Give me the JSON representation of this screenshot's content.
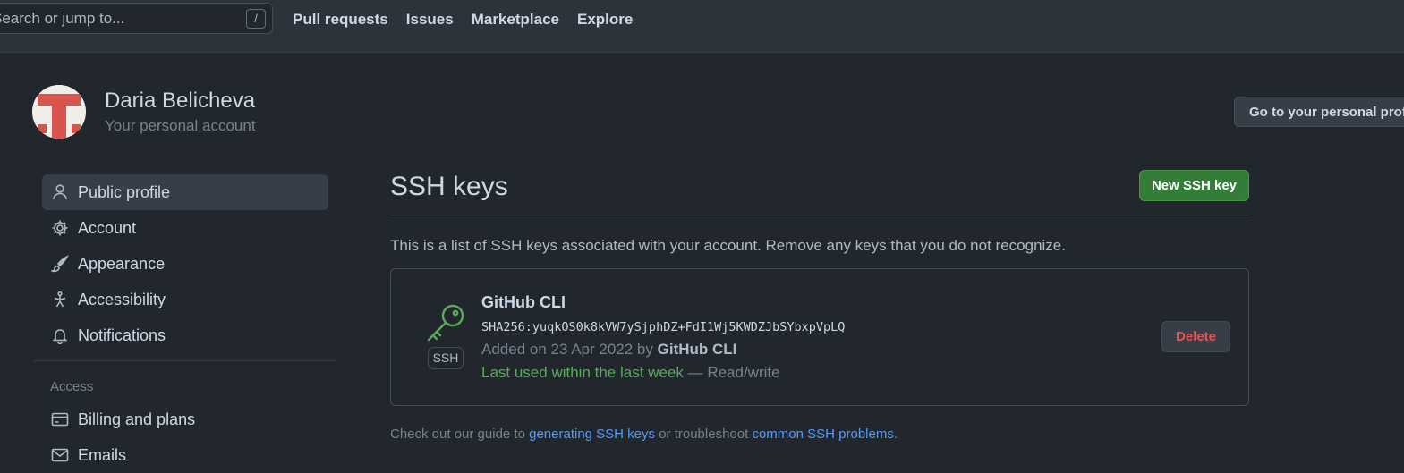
{
  "header": {
    "search_placeholder": "Search or jump to...",
    "search_shortcut": "/",
    "nav": [
      "Pull requests",
      "Issues",
      "Marketplace",
      "Explore"
    ]
  },
  "profile": {
    "name": "Daria Belicheva",
    "subtitle": "Your personal account",
    "goto_button": "Go to your personal profile"
  },
  "sidebar": {
    "items": [
      {
        "label": "Public profile",
        "icon": "person-icon"
      },
      {
        "label": "Account",
        "icon": "gear-icon"
      },
      {
        "label": "Appearance",
        "icon": "paintbrush-icon"
      },
      {
        "label": "Accessibility",
        "icon": "accessibility-icon"
      },
      {
        "label": "Notifications",
        "icon": "bell-icon"
      }
    ],
    "access_heading": "Access",
    "access_items": [
      {
        "label": "Billing and plans",
        "icon": "credit-card-icon"
      },
      {
        "label": "Emails",
        "icon": "mail-icon"
      }
    ]
  },
  "main": {
    "title": "SSH keys",
    "new_button": "New SSH key",
    "intro": "This is a list of SSH keys associated with your account. Remove any keys that you do not recognize.",
    "key": {
      "title": "GitHub CLI",
      "badge": "SSH",
      "fingerprint": "SHA256:yuqkOS0k8kVW7ySjphDZ+FdI1Wj5KWDZJbSYbxpVpLQ",
      "added_prefix": "Added on 23 Apr 2022 by",
      "added_by": "GitHub CLI",
      "last_used": "Last used within the last week",
      "access": "— Read/write",
      "delete_button": "Delete"
    },
    "help": {
      "prefix": "Check out our guide to",
      "link1": "generating SSH keys",
      "middle": "or troubleshoot",
      "link2": "common SSH problems",
      "suffix": "."
    }
  },
  "colors": {
    "background": "#22272e",
    "header": "#2d333b",
    "primary_button": "#347d39",
    "danger": "#e5534b",
    "link": "#539bf5",
    "key_icon": "#57ab5a"
  }
}
